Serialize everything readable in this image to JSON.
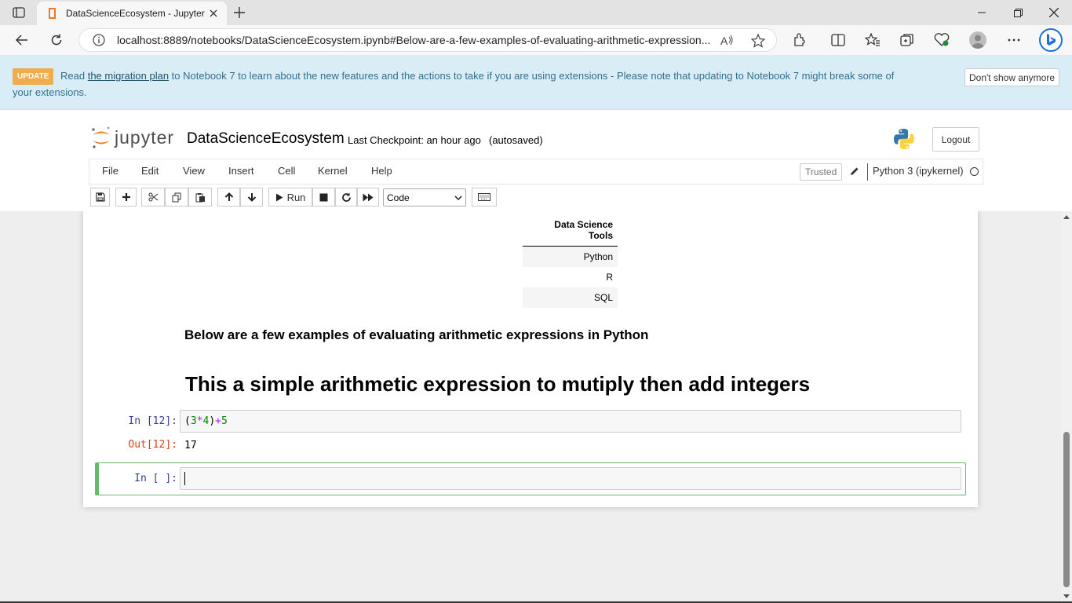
{
  "browser": {
    "tab_title": "DataScienceEcosystem - Jupyter",
    "url": "localhost:8889/notebooks/DataScienceEcosystem.ipynb#Below-are-a-few-examples-of-evaluating-arithmetic-expression..."
  },
  "banner": {
    "badge": "UPDATE",
    "text_before": "Read",
    "link": "the migration plan",
    "text_after": "to Notebook 7 to learn about the new features and the actions to take if you are using extensions - Please note that updating to Notebook 7 might break some of your extensions.",
    "dismiss": "Don't show anymore"
  },
  "header": {
    "logo_text": "jupyter",
    "notebook_name": "DataScienceEcosystem",
    "checkpoint": "Last Checkpoint: an hour ago",
    "autosave": "(autosaved)",
    "logout": "Logout"
  },
  "menubar": {
    "items": [
      "File",
      "Edit",
      "View",
      "Insert",
      "Cell",
      "Kernel",
      "Help"
    ],
    "trusted": "Trusted",
    "kernel": "Python 3 (ipykernel)"
  },
  "toolbar": {
    "run_label": "Run",
    "cell_type": "Code"
  },
  "notebook": {
    "table": {
      "header": "Data Science Tools",
      "rows": [
        "Python",
        "R",
        "SQL"
      ]
    },
    "md_h3": "Below are a few examples of evaluating arithmetic expressions in Python",
    "md_h1": "This a simple arithmetic expression to mutiply then add integers",
    "cell1": {
      "in_prompt": "In [12]:",
      "code": {
        "t1": "(",
        "t2": "3",
        "t3": "*",
        "t4": "4",
        "t5": ")",
        "t6": "+",
        "t7": "5"
      },
      "out_prompt": "Out[12]:",
      "output": "17"
    },
    "cell2": {
      "in_prompt": "In [ ]:"
    }
  },
  "colors": {
    "banner_bg": "#d9edf7",
    "badge": "#f0ad4e",
    "selected_cell": "#66bb6a",
    "in_prompt": "#303f9f",
    "out_prompt": "#d84315"
  }
}
